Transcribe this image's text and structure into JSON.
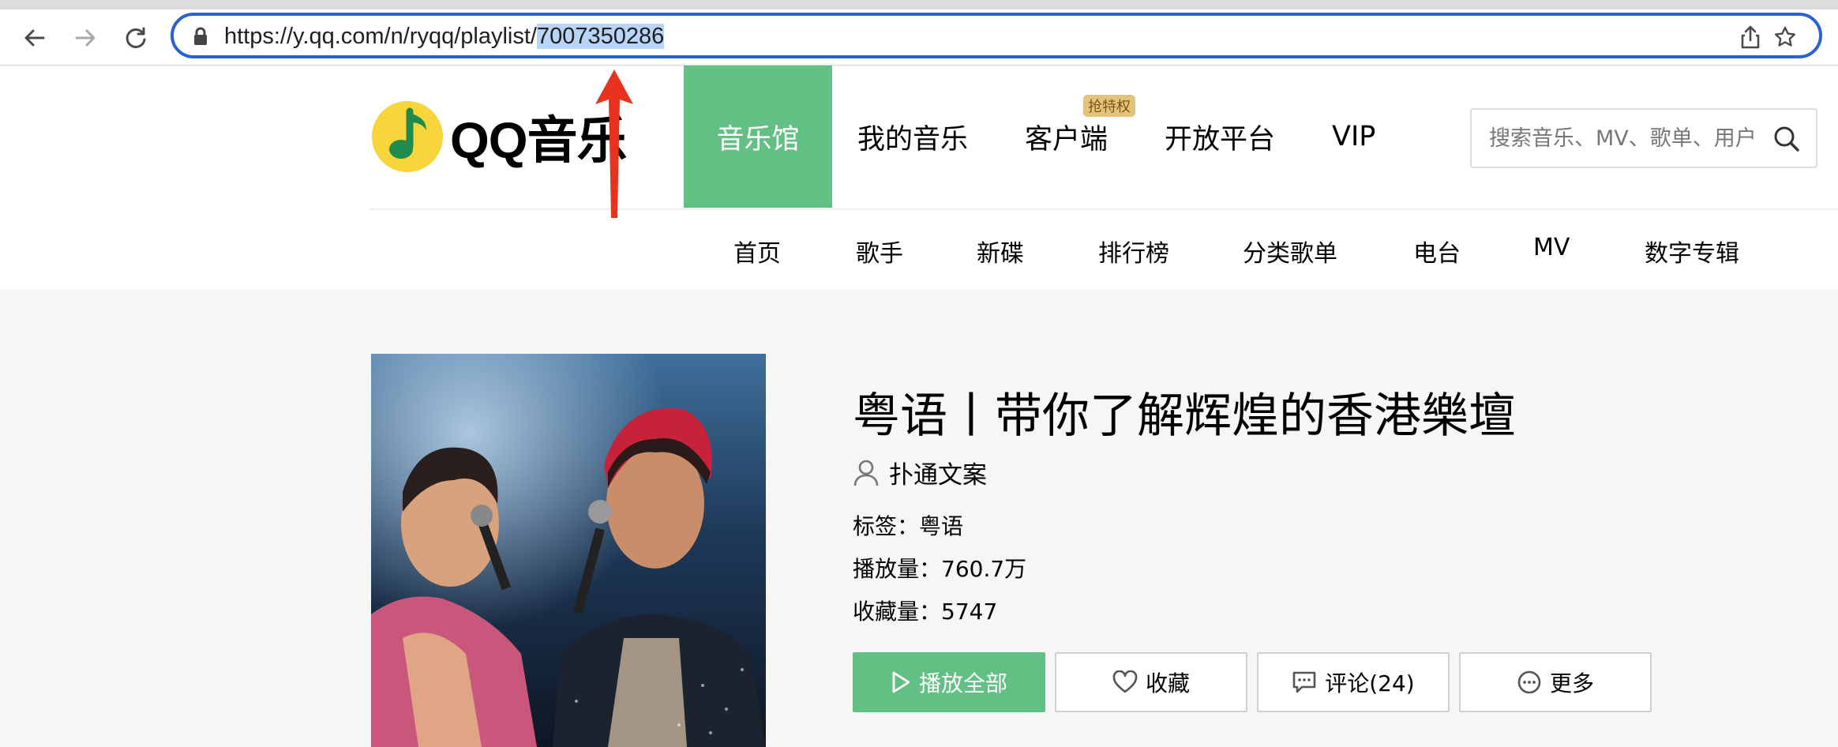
{
  "browser": {
    "url_prefix": "https://y.qq.com/n/ryqq/playlist/",
    "url_selected": "7007350286"
  },
  "header": {
    "logo_text": "QQ音乐",
    "nav": [
      {
        "label": "音乐馆",
        "active": true
      },
      {
        "label": "我的音乐"
      },
      {
        "label": "客户端",
        "badge": "抢特权"
      },
      {
        "label": "开放平台"
      },
      {
        "label": "VIP"
      }
    ],
    "search_placeholder": "搜索音乐、MV、歌单、用户",
    "subnav": [
      "首页",
      "歌手",
      "新碟",
      "排行榜",
      "分类歌单",
      "电台",
      "MV",
      "数字专辑"
    ]
  },
  "playlist": {
    "title": "粤语丨带你了解辉煌的香港樂壇",
    "creator": "扑通文案",
    "tag_label": "标签：",
    "tag_value": "粤语",
    "plays_label": "播放量：",
    "plays_value": "760.7万",
    "favs_label": "收藏量：",
    "favs_value": "5747",
    "buttons": {
      "play_all": "播放全部",
      "favorite": "收藏",
      "comment": "评论(24)",
      "more": "更多"
    }
  },
  "colors": {
    "brand_green": "#62c084",
    "address_focus": "#2a62d0",
    "annotation_arrow": "#e8321e"
  }
}
